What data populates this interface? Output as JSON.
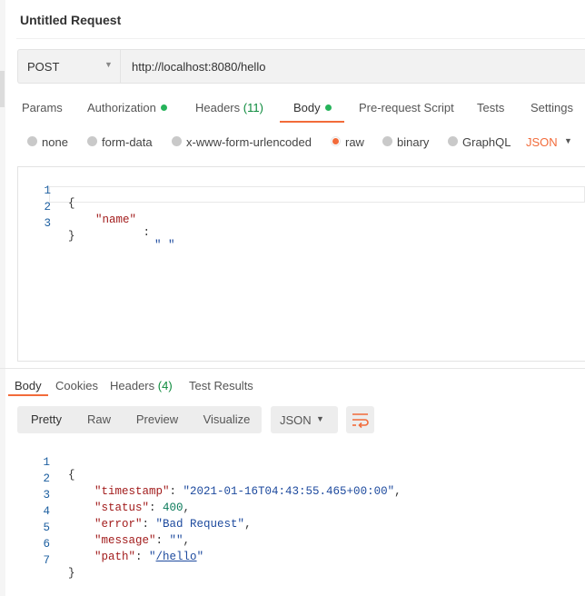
{
  "request": {
    "title": "Untitled Request",
    "method": "POST",
    "url": "http://localhost:8080/hello"
  },
  "tabs": [
    {
      "label": "Params"
    },
    {
      "label": "Authorization"
    },
    {
      "label": "Headers",
      "count": "(11)"
    },
    {
      "label": "Body"
    },
    {
      "label": "Pre-request Script"
    },
    {
      "label": "Tests"
    },
    {
      "label": "Settings"
    }
  ],
  "body_types": [
    "none",
    "form-data",
    "x-www-form-urlencoded",
    "raw",
    "binary",
    "GraphQL"
  ],
  "body_type_selected": "raw",
  "language": "JSON",
  "request_body": {
    "line_numbers": [
      "1",
      "2",
      "3"
    ],
    "open_brace": "{",
    "key": "\"name\"",
    "sep": " : ",
    "value": "\" \"",
    "close_brace": "}"
  },
  "response_tabs": [
    {
      "label": "Body"
    },
    {
      "label": "Cookies"
    },
    {
      "label": "Headers",
      "count": "(4)"
    },
    {
      "label": "Test Results"
    }
  ],
  "view_modes": [
    "Pretty",
    "Raw",
    "Preview",
    "Visualize"
  ],
  "response_format": "JSON",
  "response_body": {
    "line_numbers": [
      "1",
      "2",
      "3",
      "4",
      "5",
      "6",
      "7"
    ],
    "open_brace": "{",
    "timestamp_key": "\"timestamp\"",
    "timestamp_value": "\"2021-01-16T04:43:55.465+00:00\"",
    "status_key": "\"status\"",
    "status_value": "400",
    "error_key": "\"error\"",
    "error_value": "\"Bad Request\"",
    "message_key": "\"message\"",
    "message_value": "\"\"",
    "path_key": "\"path\"",
    "path_quote_open": "\"",
    "path_value": "/hello",
    "path_quote_close": "\"",
    "close_brace": "}",
    "colon": ": ",
    "comma": ","
  },
  "colors": {
    "accent": "#f26b3a",
    "status_green": "#26b35a",
    "json_key": "#a21c1c",
    "json_string": "#1d4a9e",
    "json_number": "#0a7a5a"
  },
  "icons": {
    "method_dropdown": "chevron-down-icon",
    "language_dropdown": "chevron-down-icon",
    "wrap_lines": "wrap-lines-icon"
  }
}
